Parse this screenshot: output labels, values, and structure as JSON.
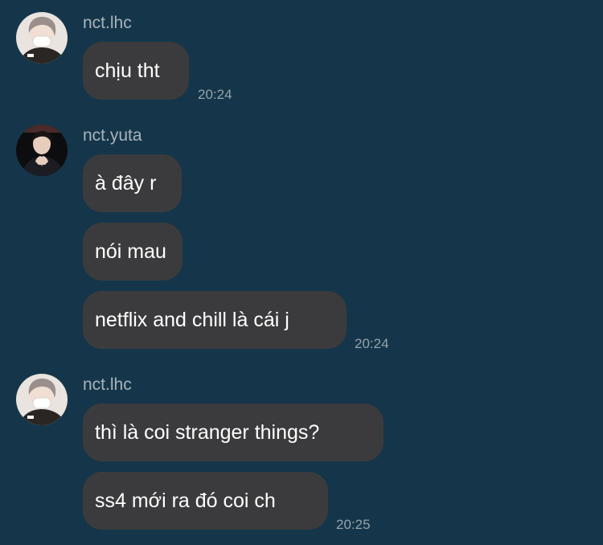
{
  "colors": {
    "background": "#15364a",
    "bubble": "#3b3b3d",
    "message_text": "#ffffff",
    "username_text": "#a8b3bb",
    "time_text": "#95a2ab"
  },
  "groups": [
    {
      "username": "nct.lhc",
      "avatar": "masked-user-avatar-icon",
      "messages": [
        "chịu tht"
      ],
      "time": "20:24"
    },
    {
      "username": "nct.yuta",
      "avatar": "dark-suit-user-avatar-icon",
      "messages": [
        "à đây r",
        "nói mau",
        "netflix and chill là cái j"
      ],
      "time": "20:24"
    },
    {
      "username": "nct.lhc",
      "avatar": "masked-user-avatar-icon",
      "messages": [
        "thì là coi stranger things?",
        "ss4 mới ra đó coi ch"
      ],
      "time": "20:25"
    }
  ]
}
